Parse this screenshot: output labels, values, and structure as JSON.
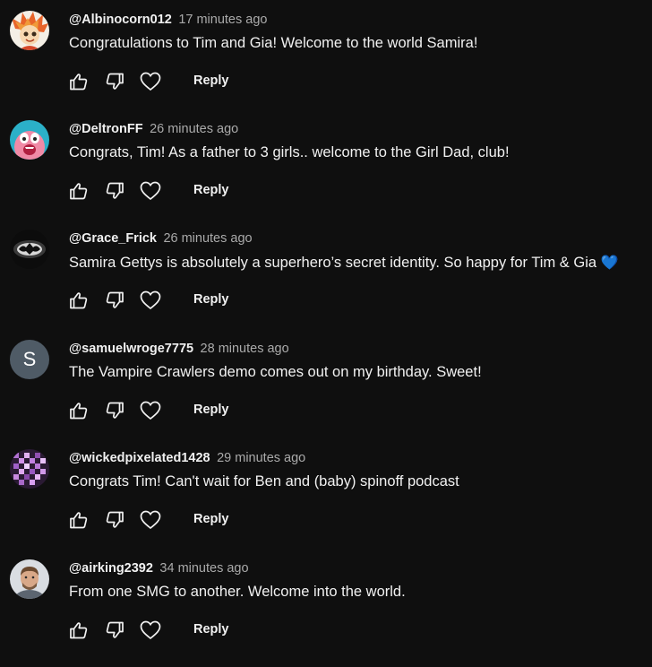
{
  "actions": {
    "reply_label": "Reply"
  },
  "comments": [
    {
      "handle": "@Albinocorn012",
      "time": "17 minutes ago",
      "text": "Congratulations to Tim and Gia! Welcome to the world Samira!",
      "avatar": "cartoon-avatar"
    },
    {
      "handle": "@DeltronFF",
      "time": "26 minutes ago",
      "text": "Congrats, Tim! As a father to 3 girls.. welcome to the Girl Dad, club!",
      "avatar": "cartoon-avatar"
    },
    {
      "handle": "@Grace_Frick",
      "time": "26 minutes ago",
      "text": "Samira Gettys is absolutely a superhero’s secret identity. So happy for Tim & Gia",
      "emoji": "💙",
      "avatar": "photo-avatar"
    },
    {
      "handle": "@samuelwroge7775",
      "time": "28 minutes ago",
      "text": "The Vampire Crawlers demo comes out on my birthday. Sweet!",
      "avatar": "initial-avatar",
      "initial": "S"
    },
    {
      "handle": "@wickedpixelated1428",
      "time": "29 minutes ago",
      "text": "Congrats Tim! Can't wait for Ben and (baby) spinoff podcast",
      "avatar": "pixel-avatar"
    },
    {
      "handle": "@airking2392",
      "time": "34 minutes ago",
      "text": "From one SMG to another. Welcome into the world.",
      "avatar": "photo-avatar"
    }
  ]
}
